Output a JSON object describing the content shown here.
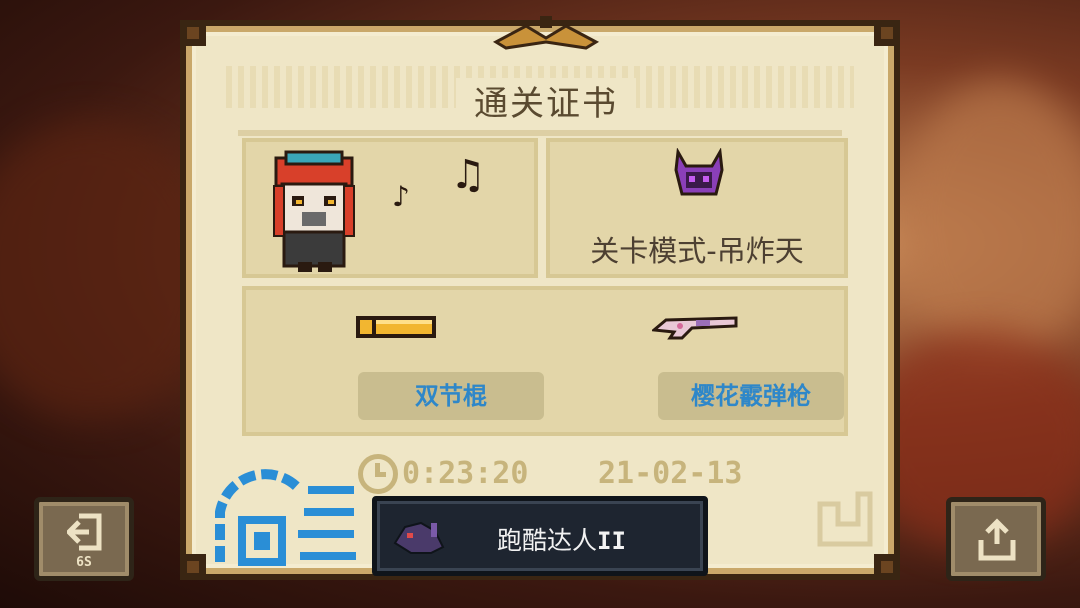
{
  "certificate": {
    "title": "通关证书",
    "mode_label": "关卡模式-吊炸天",
    "weapon1_name": "双节棍",
    "weapon2_name": "樱花霰弹枪",
    "clear_time": "0:23:20",
    "clear_date": "21-02-13"
  },
  "achievement": {
    "name": "跑酷达人",
    "rank": "II"
  },
  "buttons": {
    "exit_count": "6S"
  },
  "icons": {
    "character": "character-portrait-icon",
    "music": "music-note-icon",
    "mode": "demon-helmet-icon",
    "weapon1": "nunchaku-icon",
    "weapon2": "shotgun-icon",
    "clock": "clock-icon",
    "exit": "exit-icon",
    "share": "share-icon",
    "achievement": "achievement-creature-icon",
    "seal": "stamp-seal-icon"
  },
  "colors": {
    "weapon_label": "#2e87c9",
    "stat_text": "#c7b47c",
    "paper": "#efe6c6",
    "frame": "#3a2512",
    "stamp": "#2a8ed6"
  }
}
